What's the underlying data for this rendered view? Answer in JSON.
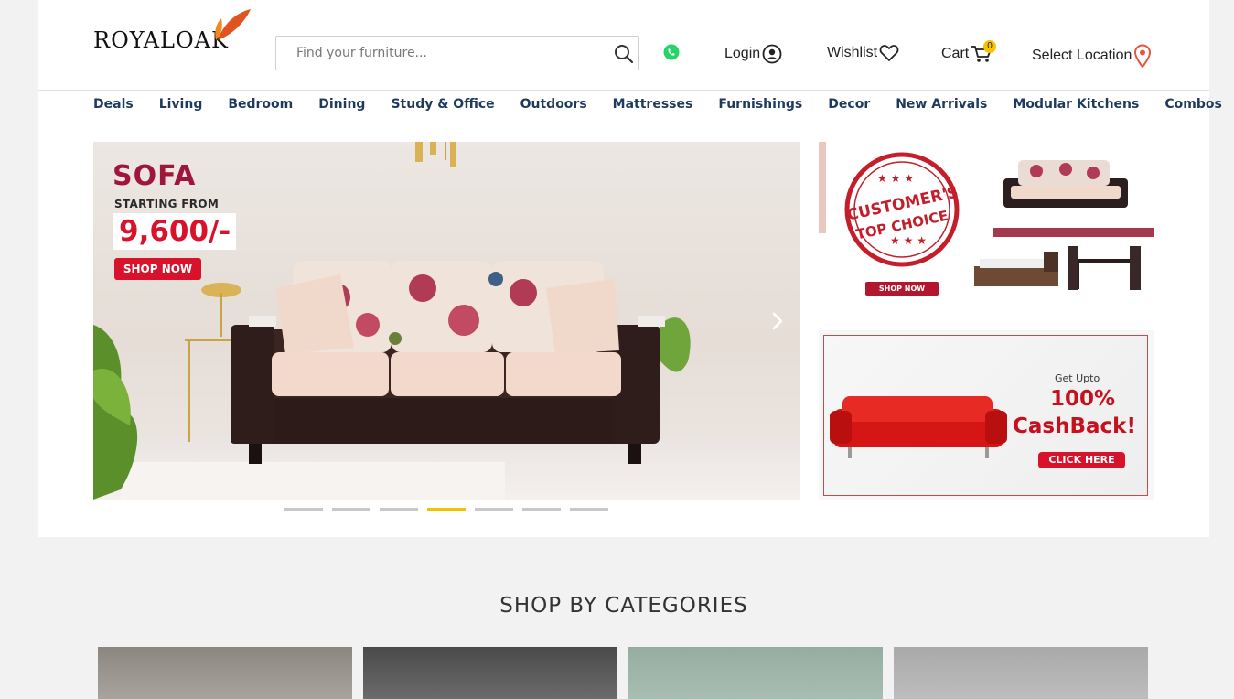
{
  "header": {
    "logo_text": "ROYALOAK",
    "search_placeholder": "Find your furniture...",
    "login_label": "Login",
    "wishlist_label": "Wishlist",
    "cart_label": "Cart",
    "cart_count": "0",
    "location_label": "Select Location"
  },
  "nav": {
    "items": [
      "Deals",
      "Living",
      "Bedroom",
      "Dining",
      "Study & Office",
      "Outdoors",
      "Mattresses",
      "Furnishings",
      "Decor",
      "New Arrivals",
      "Modular Kitchens",
      "Combos"
    ]
  },
  "hero": {
    "title": "SOFA",
    "subtitle": "STARTING FROM",
    "price": "9,600/-",
    "cta": "SHOP NOW",
    "slide_count": 7,
    "active_slide": 4
  },
  "promo_top": {
    "stamp_line1": "CUSTOMER'S",
    "stamp_line2": "TOP CHOICE",
    "cta": "SHOP NOW"
  },
  "promo_bottom": {
    "get_upto": "Get Upto",
    "percent": "100%",
    "cashback": "CashBack!",
    "cta": "CLICK HERE"
  },
  "categories": {
    "title": "SHOP BY CATEGORIES"
  },
  "colors": {
    "nav_text": "#1f3a5f",
    "accent_red": "#d8122a",
    "slider_active": "#f2c200",
    "cart_badge": "#f5c400",
    "location_pin": "#e8553e",
    "whatsapp": "#25d366"
  }
}
